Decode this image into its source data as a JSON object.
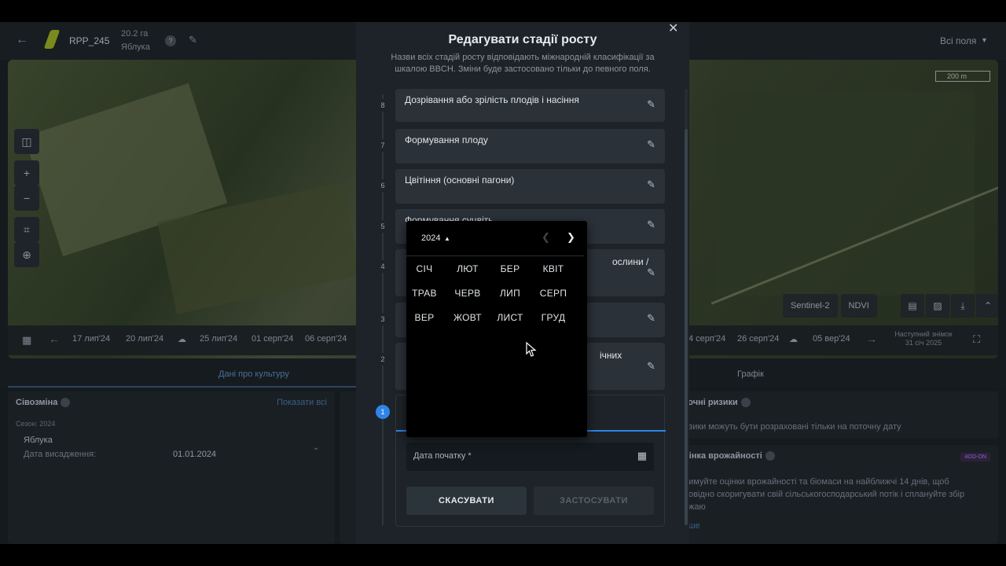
{
  "background": {
    "field_name": "RPP_245",
    "field_area": "20.2 га",
    "field_crop": "Яблука",
    "field_selector": "Всі поля",
    "scale_label": "200 m",
    "map_selects": [
      "Sentinel-2",
      "NDVI"
    ],
    "timeline_dates": [
      "17 лип'24",
      "20 лип'24",
      "25 лип'24",
      "01 серп'24",
      "06 серп'24",
      "4 серп'24",
      "26 серп'24",
      "05 вер'24"
    ],
    "next_image_label": "Наступний знімок",
    "next_image_date": "31 січ 2025",
    "tab_crop_data": "Дані про культуру",
    "tab_chart": "Графік",
    "rotation_title": "Сівозміна",
    "rotation_link": "Показати всі",
    "season_label": "Сезон: 2024",
    "crop_name": "Яблука",
    "planting_label": "Дата висадження:",
    "planting_date": "01.01.2024",
    "risks_title": "точні ризики",
    "risks_text": "изики можуть бути розраховані тільки на поточну дату",
    "yield_title": "цінка врожайності",
    "addon_badge": "ADD-ON",
    "yield_text_1": "римуйте оцінки врожайності та біомаси на найближчі 14 днів, щоб",
    "yield_text_2": "повідно скоригувати свій сільськогосподарський потік і сплануйте збір",
    "yield_text_3": "ожаю",
    "yield_more": "ьше"
  },
  "dialog": {
    "title": "Редагувати стадії росту",
    "subtitle": "Назви всіх стадій росту відповідають міжнародній класифікації за шкалою BBCH. Зміни буде застосовано тільки до певного поля.",
    "stages": [
      {
        "num": "8",
        "label": "Дозрівання або зрілість плодів і насіння"
      },
      {
        "num": "7",
        "label": "Формування плоду"
      },
      {
        "num": "6",
        "label": "Цвітіння (основні пагони)"
      },
      {
        "num": "5",
        "label": "Формування суцвіть"
      },
      {
        "num": "4",
        "label": "Розвиток частин рослини, що збираються / вегетативне розмноження",
        "visible_tail": "ослини /"
      },
      {
        "num": "3",
        "label": ""
      },
      {
        "num": "2",
        "label": "",
        "visible_tail": "ічних"
      },
      {
        "num": "1",
        "label": ""
      }
    ],
    "date_label": "Дата початку *",
    "cancel_label": "СКАСУВАТИ",
    "apply_label": "ЗАСТОСУВАТИ"
  },
  "picker": {
    "year": "2024",
    "months": [
      "СІЧ",
      "ЛЮТ",
      "БЕР",
      "КВІТ",
      "ТРАВ",
      "ЧЕРВ",
      "ЛИП",
      "СЕРП",
      "ВЕР",
      "ЖОВТ",
      "ЛИСТ",
      "ГРУД"
    ],
    "highlighted_month": "СІЧ"
  },
  "colors": {
    "accent": "#2f84e8",
    "dialog_bg": "#1d2328",
    "card_bg": "#2a3138",
    "picker_bg": "#000000"
  }
}
